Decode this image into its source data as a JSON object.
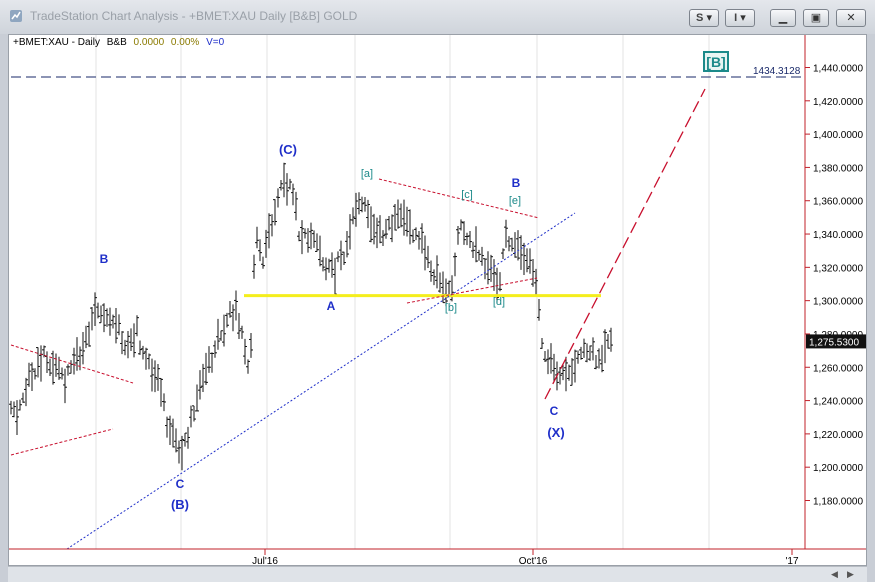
{
  "window": {
    "title": "TradeStation Chart Analysis - +BMET:XAU Daily [B&B] GOLD",
    "buttons": {
      "s_label": "S",
      "i_label": "I"
    }
  },
  "info_line": {
    "symbol": "+BMET:XAU - Daily",
    "study": "B&B",
    "value1": "0.0000",
    "value2": "0.00%",
    "value3": "V=0"
  },
  "colors": {
    "yellow_line": "#f4ee1c",
    "wave_blue": "#1f2fc9",
    "wave_teal": "#1c8a8a",
    "trend_red": "#c8102e",
    "axis_red": "#c0202a",
    "price_box": "#111111"
  },
  "axis": {
    "price_ticks": [
      "1,440.0000",
      "1,420.0000",
      "1,400.0000",
      "1,380.0000",
      "1,360.0000",
      "1,340.0000",
      "1,320.0000",
      "1,300.0000",
      "1,280.0000",
      "1,260.0000",
      "1,240.0000",
      "1,220.0000",
      "1,200.0000",
      "1,180.0000"
    ],
    "date_ticks": [
      "Jul'16",
      "Oct'16",
      "'17"
    ],
    "last_price": "1,275.5300",
    "dashed_level": "1434.3128"
  },
  "labels": {
    "B_left": "B",
    "C_bottom": "C",
    "B_bottom": "(B)",
    "C_top": "(C)",
    "A_mid": "A",
    "a_sq": "[a]",
    "b_sq": "[b]",
    "c_sq": "[c]",
    "d_sq": "[d]",
    "e_sq": "[e]",
    "B_right": "B",
    "C_right": "C",
    "X_right": "(X)",
    "B_target": "[B]"
  },
  "chart_data": {
    "type": "bar",
    "y_axis": {
      "range": [
        1160,
        1450
      ],
      "step": 20
    },
    "price_ticks": [
      1440,
      1420,
      1400,
      1380,
      1360,
      1340,
      1320,
      1300,
      1280,
      1260,
      1240,
      1220,
      1200,
      1180
    ],
    "date_ticks": [
      "Jul'16",
      "Oct'16",
      "'17"
    ],
    "last_price": 1275.53,
    "dashed_level": 1434.3128,
    "horizontal_line": 1303
  }
}
